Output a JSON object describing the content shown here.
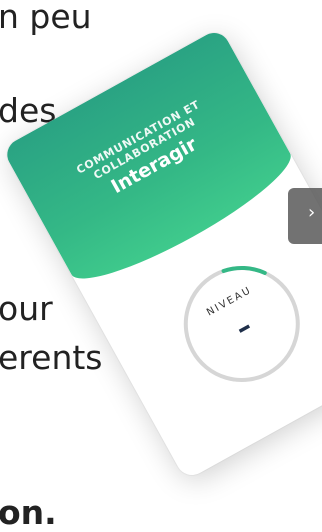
{
  "background_text": {
    "line1": "n peu",
    "line2": "des",
    "line3": "our",
    "line4": "erents",
    "line5": "on."
  },
  "card": {
    "category": "COMMUNICATION ET COLLABORATION",
    "title": "Interagir",
    "accent_color": "#34b886",
    "level": {
      "label": "NIVEAU",
      "value": "–",
      "progress_fraction": 0.12
    }
  },
  "next_button": {
    "label": "›"
  }
}
